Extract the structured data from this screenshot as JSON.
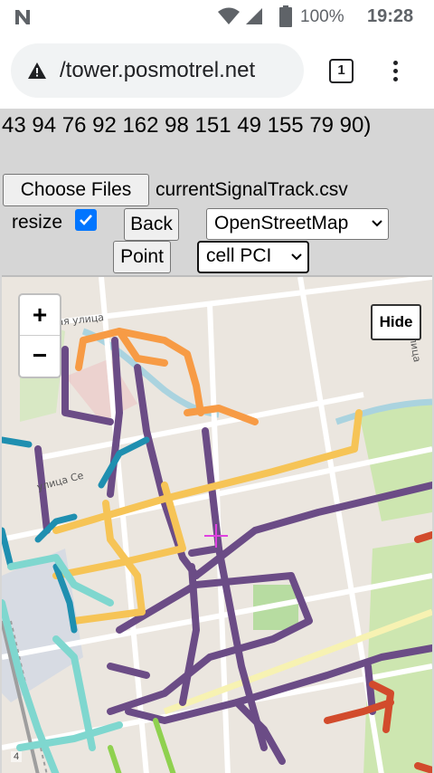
{
  "status_bar": {
    "battery": "100%",
    "time": "19:28"
  },
  "browser": {
    "url": "/tower.posmotrel.net",
    "tab_count": "1"
  },
  "page": {
    "coords_text": "43 94 76 92 162 98 151 49 155 79 90)",
    "choose_files_label": "Choose Files",
    "file_name": "currentSignalTrack.csv",
    "resize_label": "resize",
    "resize_checked": true,
    "back_label": "Back",
    "map_select": "OpenStreetMap",
    "point_label": "Point",
    "metric_select": "cell PCI"
  },
  "map": {
    "zoom_in": "+",
    "zoom_out": "−",
    "hide_label": "Hide",
    "street_label_1": "ежная улица",
    "street_label_2": "улица Се",
    "street_label_3": "Улица",
    "scale_text": "4",
    "track_colors": {
      "purple": "#6b4c86",
      "yellow": "#f6c456",
      "orange": "#f79b45",
      "teal": "#1f8fb0",
      "aqua": "#7fd7cf",
      "red": "#d24b2c",
      "green": "#8fd14f"
    },
    "crosshair_color": "#e040e0"
  }
}
